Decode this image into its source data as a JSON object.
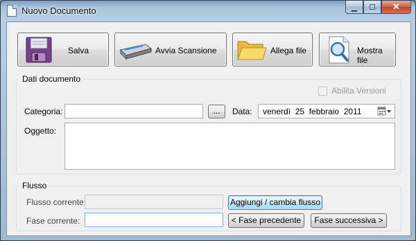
{
  "window": {
    "title": "Nuovo Documento",
    "caption_buttons": {
      "minimize": "▁",
      "maximize": "☐",
      "close": "✕"
    }
  },
  "toolbar": {
    "save_label": "Salva",
    "scan_label": "Avvia Scansione",
    "attach_label": "Allega file",
    "show_label": "Mostra file"
  },
  "icons": {
    "save": "floppy-disk-icon",
    "scan": "scanner-icon",
    "attach": "folder-icon",
    "show": "magnifier-document-icon"
  },
  "dati": {
    "legend": "Dati documento",
    "versions_label": "Abilita Versioni",
    "versions_checked": false,
    "category_label": "Categoria:",
    "category_value": "",
    "browse_label": "...",
    "date_label": "Data:",
    "date_value": "venerdì  25  febbraio  2011",
    "subject_label": "Oggetto:",
    "subject_value": ""
  },
  "flusso": {
    "legend": "Flusso",
    "current_flow_label": "Flusso corrente:",
    "current_flow_value": "",
    "change_flow_label": "Aggiungi / cambia flusso",
    "current_phase_label": "Fase corrente:",
    "current_phase_value": "",
    "prev_phase_label": "< Fase precedente",
    "next_phase_label": "Fase successiva >"
  },
  "colors": {
    "focus_border": "#3c7fb1",
    "close_red": "#c0402a",
    "titlebar": "#a9c4dc"
  }
}
